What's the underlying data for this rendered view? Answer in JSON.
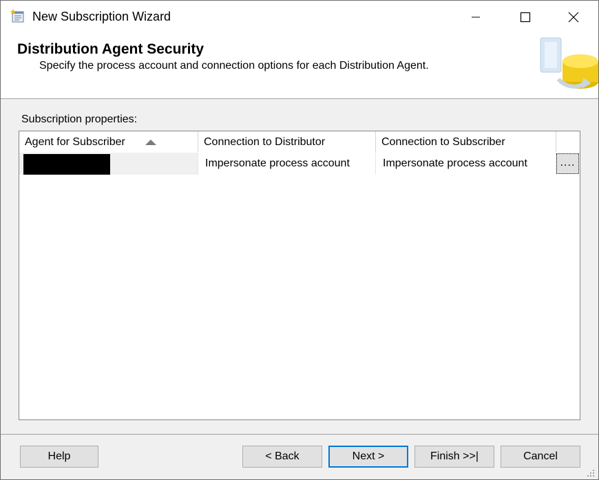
{
  "window": {
    "title": "New Subscription Wizard",
    "icon": "wizard-icon"
  },
  "header": {
    "title": "Distribution Agent Security",
    "subtitle": "Specify the process account and connection options for each Distribution Agent."
  },
  "grid": {
    "label": "Subscription properties:",
    "columns": [
      "Agent for Subscriber",
      "Connection to Distributor",
      "Connection to Subscriber"
    ],
    "sorted_column": "Agent for Subscriber",
    "sort_direction": "ascending",
    "rows": [
      {
        "agent_for_subscriber": "",
        "connection_to_distributor": "Impersonate process account",
        "connection_to_subscriber": "Impersonate process account",
        "action_label": "...."
      }
    ]
  },
  "buttons": {
    "help": "Help",
    "back": "< Back",
    "next": "Next >",
    "finish": "Finish >>|",
    "cancel": "Cancel"
  },
  "colors": {
    "dialog_bg": "#f0f0f0",
    "default_button_border": "#0078d7",
    "button_bg": "#e1e1e1"
  }
}
